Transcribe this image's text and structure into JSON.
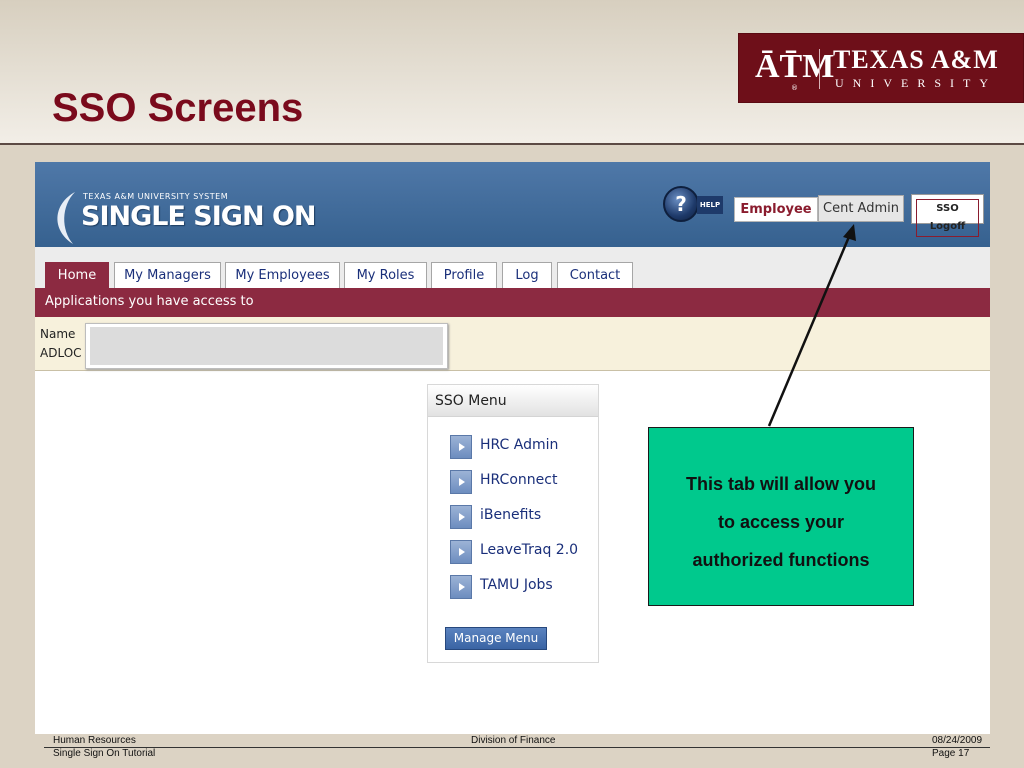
{
  "slide": {
    "title": "SSO Screens",
    "logo": {
      "mark": "ĀT̄M",
      "name": "TEXAS A&M",
      "sub": "UNIVERSITY",
      "registered": "®"
    }
  },
  "banner": {
    "system": "TEXAS A&M UNIVERSITY SYSTEM",
    "title": "SINGLE SIGN ON",
    "help_label": "HELP",
    "help_glyph": "?",
    "employee_tab": "Employee",
    "cent_admin_tab": "Cent Admin",
    "logoff_label": "SSO Logoff"
  },
  "nav": {
    "tabs": [
      {
        "label": "Home"
      },
      {
        "label": "My Managers"
      },
      {
        "label": "My Employees"
      },
      {
        "label": "My Roles"
      },
      {
        "label": "Profile"
      },
      {
        "label": "Log"
      },
      {
        "label": "Contact"
      }
    ]
  },
  "apps_bar": {
    "text": "Applications you have access to"
  },
  "info": {
    "name_label": "Name",
    "adloc_label": "ADLOC"
  },
  "sso_menu": {
    "title": "SSO Menu",
    "items": [
      {
        "label": "HRC Admin"
      },
      {
        "label": "HRConnect"
      },
      {
        "label": "iBenefits"
      },
      {
        "label": "LeaveTraq 2.0"
      },
      {
        "label": "TAMU Jobs"
      }
    ],
    "manage_label": "Manage Menu"
  },
  "callout": {
    "lines": [
      "This tab will allow you",
      "to access your",
      "authorized functions"
    ]
  },
  "footer": {
    "left_line1": "Human Resources",
    "left_line2": "Single Sign On Tutorial",
    "center": "Division of Finance",
    "date": "08/24/2009",
    "page": "Page 17"
  },
  "colors": {
    "maroon": "#8c2a41",
    "banner_blue": "#3f6a9a",
    "callout_green": "#00c98d",
    "title_red": "#7a0a1c"
  }
}
